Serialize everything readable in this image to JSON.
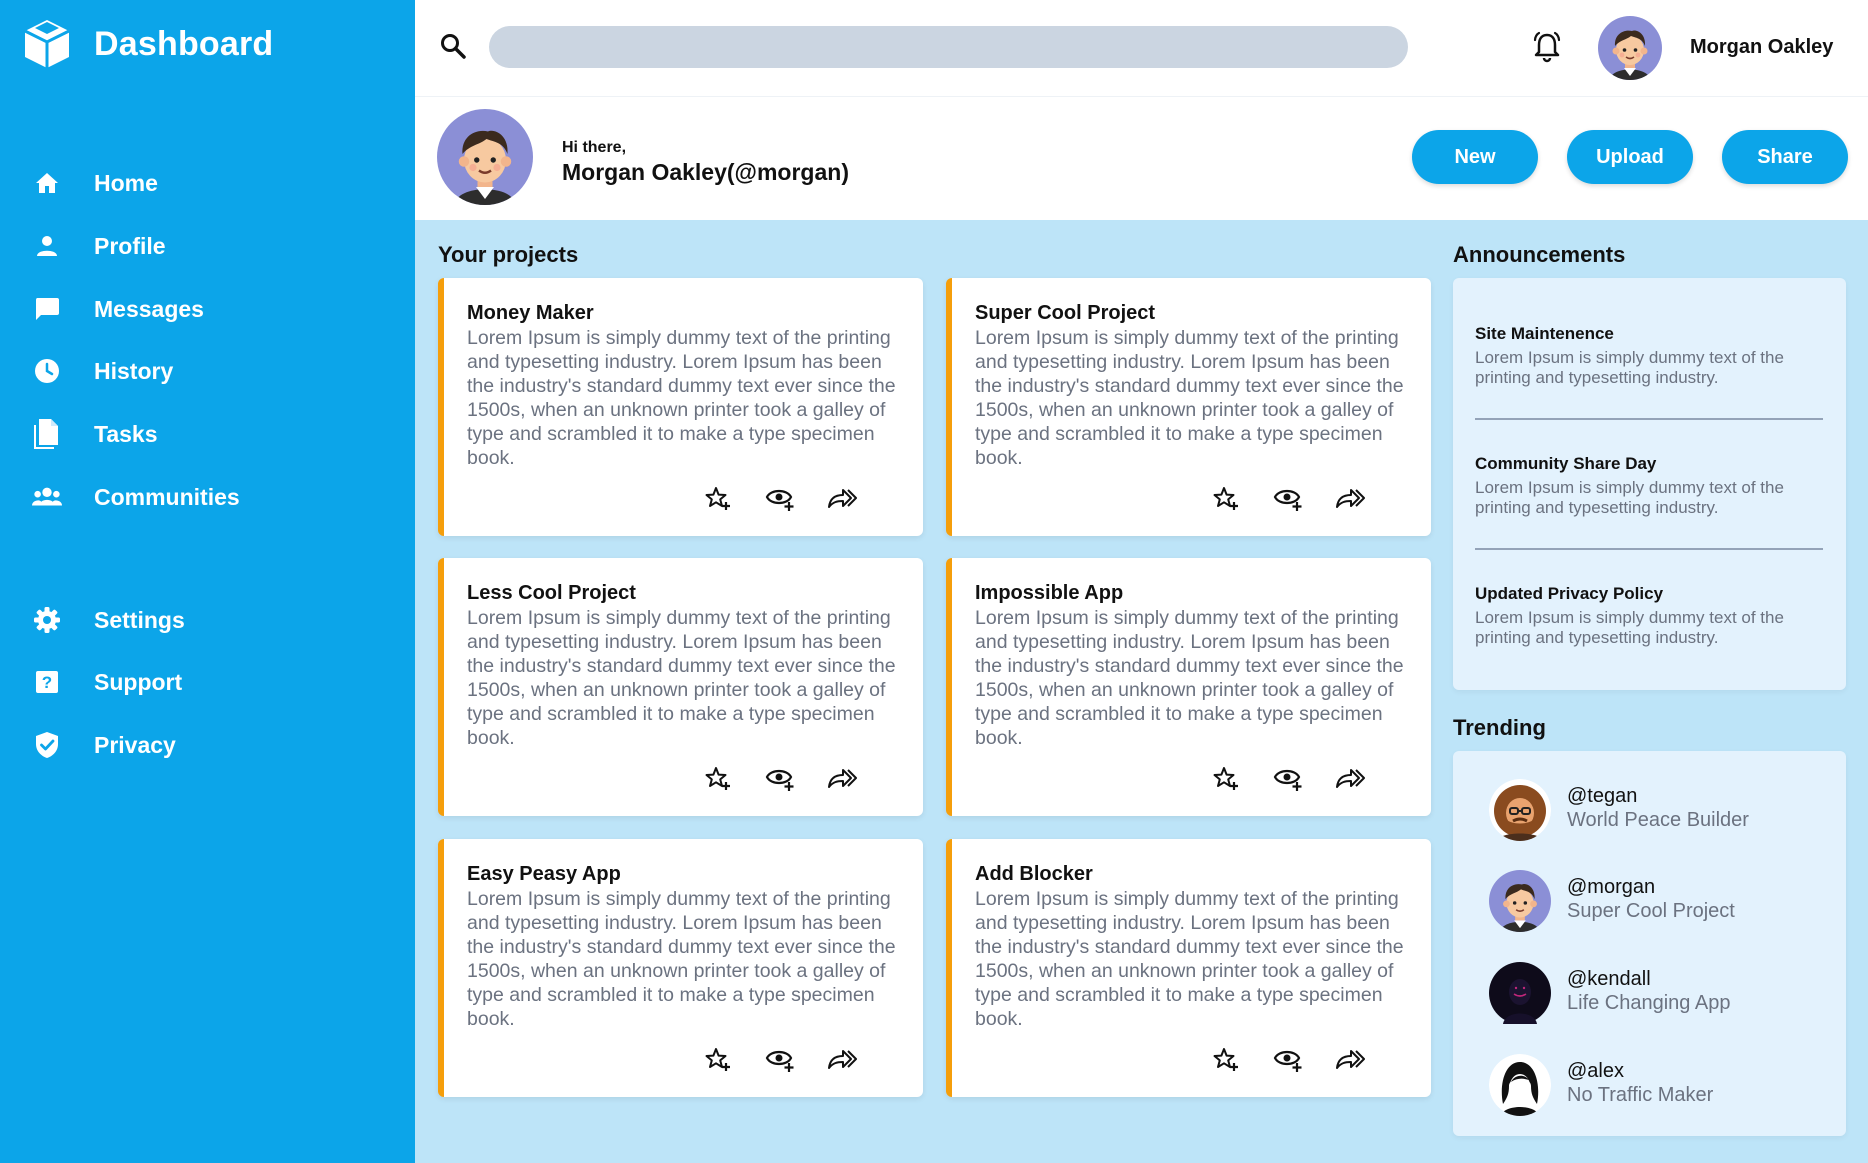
{
  "sidebar": {
    "title": "Dashboard",
    "items": [
      {
        "label": "Home",
        "icon": "home-icon"
      },
      {
        "label": "Profile",
        "icon": "person-icon"
      },
      {
        "label": "Messages",
        "icon": "chat-icon"
      },
      {
        "label": "History",
        "icon": "clock-icon"
      },
      {
        "label": "Tasks",
        "icon": "document-icon"
      },
      {
        "label": "Communities",
        "icon": "group-icon"
      }
    ],
    "bottom_items": [
      {
        "label": "Settings",
        "icon": "gear-icon"
      },
      {
        "label": "Support",
        "icon": "help-icon"
      },
      {
        "label": "Privacy",
        "icon": "shield-icon"
      }
    ]
  },
  "header": {
    "search_value": "",
    "user_name": "Morgan Oakley"
  },
  "welcome": {
    "greeting": "Hi there,",
    "user": "Morgan Oakley(@morgan)",
    "buttons": [
      "New",
      "Upload",
      "Share"
    ]
  },
  "projects": {
    "title": "Your projects",
    "items": [
      {
        "title": "Money Maker",
        "description": "Lorem Ipsum is simply dummy text of the printing and typesetting industry. Lorem Ipsum has been the industry's standard dummy text ever since the 1500s, when an unknown printer took a galley of type and scrambled it to make a type specimen book."
      },
      {
        "title": "Super Cool Project",
        "description": "Lorem Ipsum is simply dummy text of the printing and typesetting industry. Lorem Ipsum has been the industry's standard dummy text ever since the 1500s, when an unknown printer took a galley of type and scrambled it to make a type specimen book."
      },
      {
        "title": "Less Cool Project",
        "description": "Lorem Ipsum is simply dummy text of the printing and typesetting industry. Lorem Ipsum has been the industry's standard dummy text ever since the 1500s, when an unknown printer took a galley of type and scrambled it to make a type specimen book."
      },
      {
        "title": "Impossible App",
        "description": "Lorem Ipsum is simply dummy text of the printing and typesetting industry. Lorem Ipsum has been the industry's standard dummy text ever since the 1500s, when an unknown printer took a galley of type and scrambled it to make a type specimen book."
      },
      {
        "title": "Easy Peasy App",
        "description": "Lorem Ipsum is simply dummy text of the printing and typesetting industry. Lorem Ipsum has been the industry's standard dummy text ever since the 1500s, when an unknown printer took a galley of type and scrambled it to make a type specimen book."
      },
      {
        "title": "Add Blocker",
        "description": "Lorem Ipsum is simply dummy text of the printing and typesetting industry. Lorem Ipsum has been the industry's standard dummy text ever since the 1500s, when an unknown printer took a galley of type and scrambled it to make a type specimen book."
      }
    ]
  },
  "announcements": {
    "title": "Announcements",
    "items": [
      {
        "title": "Site Maintenence",
        "description": "Lorem Ipsum is simply dummy text of the printing and typesetting industry."
      },
      {
        "title": "Community Share Day",
        "description": "Lorem Ipsum is simply dummy text of the printing and typesetting industry."
      },
      {
        "title": "Updated Privacy Policy",
        "description": "Lorem Ipsum is simply dummy text of the printing and typesetting industry."
      }
    ]
  },
  "trending": {
    "title": "Trending",
    "items": [
      {
        "handle": "@tegan",
        "project": "World Peace Builder"
      },
      {
        "handle": "@morgan",
        "project": "Super Cool Project"
      },
      {
        "handle": "@kendall",
        "project": "Life Changing App"
      },
      {
        "handle": "@alex",
        "project": "No Traffic Maker"
      }
    ]
  },
  "colors": {
    "sidebar": "#0ca5e9",
    "accent": "#0ca5e9",
    "background": "#bde4f8",
    "card_border": "#f59e0b",
    "panel": "#e3f2fd"
  }
}
